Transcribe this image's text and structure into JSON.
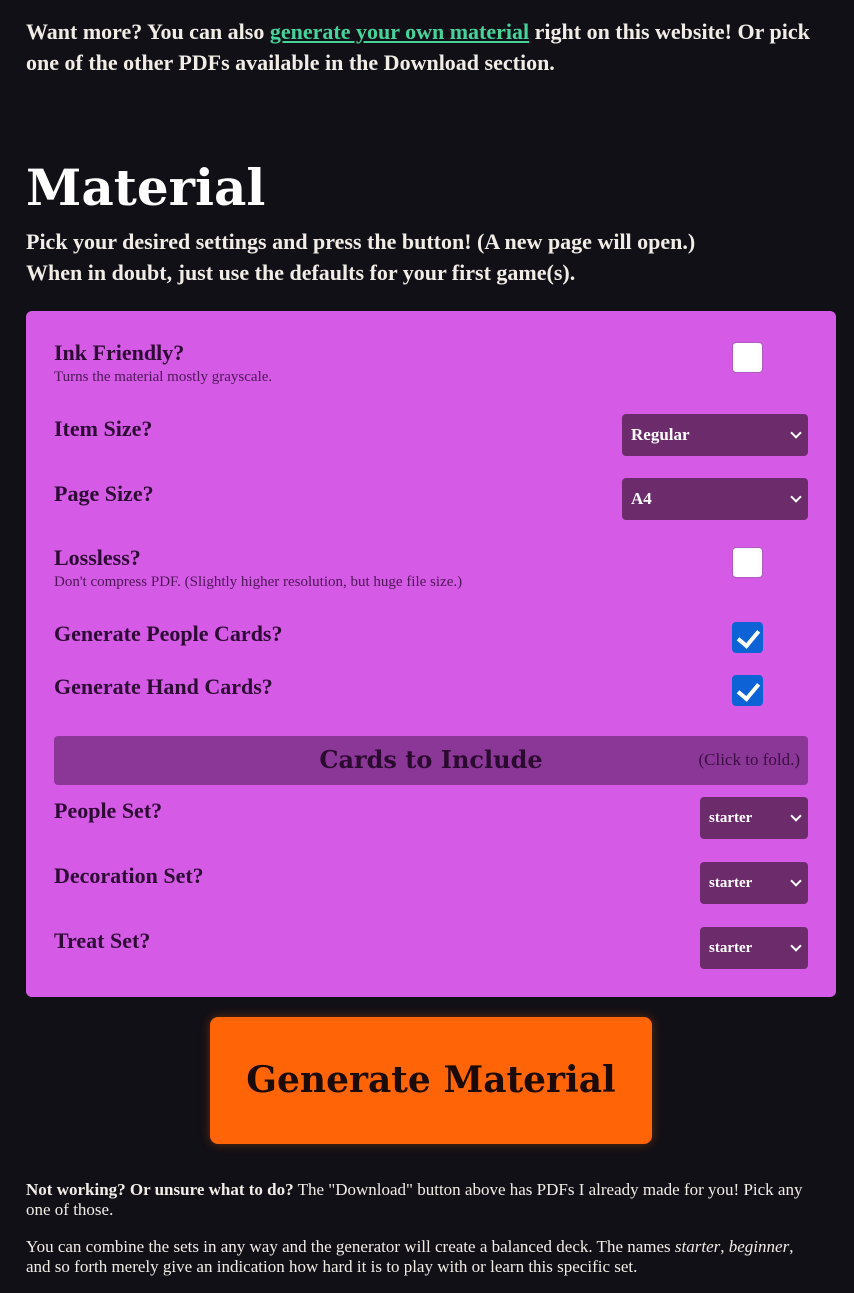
{
  "intro": {
    "prefix": "Want more? You can also ",
    "link": "generate your own material",
    "suffix": " right on this website! Or pick one of the other PDFs available in the Download section."
  },
  "section": {
    "title": "Material",
    "lead_line1": "Pick your desired settings and press the button! (A new page will open.)",
    "lead_line2": "When in doubt, just use the defaults for your first game(s)."
  },
  "settings": {
    "ink_friendly": {
      "label": "Ink Friendly?",
      "hint": "Turns the material mostly grayscale.",
      "checked": false
    },
    "item_size": {
      "label": "Item Size?",
      "value": "Regular"
    },
    "page_size": {
      "label": "Page Size?",
      "value": "A4"
    },
    "lossless": {
      "label": "Lossless?",
      "hint": "Don't compress PDF. (Slightly higher resolution, but huge file size.)",
      "checked": false
    },
    "people_cards": {
      "label": "Generate People Cards?",
      "checked": true
    },
    "hand_cards": {
      "label": "Generate Hand Cards?",
      "checked": true
    }
  },
  "cards_section": {
    "title": "Cards to Include",
    "fold_hint": "(Click to fold.)",
    "people_set": {
      "label": "People Set?",
      "value": "starter"
    },
    "decoration_set": {
      "label": "Decoration Set?",
      "value": "starter"
    },
    "treat_set": {
      "label": "Treat Set?",
      "value": "starter"
    }
  },
  "generate_button": "Generate Material",
  "footer": {
    "note1_bold": "Not working? Or unsure what to do?",
    "note1_rest": " The \"Download\" button above has PDFs I already made for you! Pick any one of those.",
    "note2_a": "You can combine the sets in any way and the generator will create a balanced deck. The names ",
    "note2_starter": "starter",
    "note2_b": ", ",
    "note2_beginner": "beginner",
    "note2_c": ", and so forth merely give an indication how hard it is to play with or learn this specific set."
  },
  "colors": {
    "background": "#111016",
    "panel": "#d55be6",
    "link": "#46d39a",
    "button": "#ff6506",
    "select": "#6c2c6c",
    "checkbox_checked": "#0d62d6"
  }
}
